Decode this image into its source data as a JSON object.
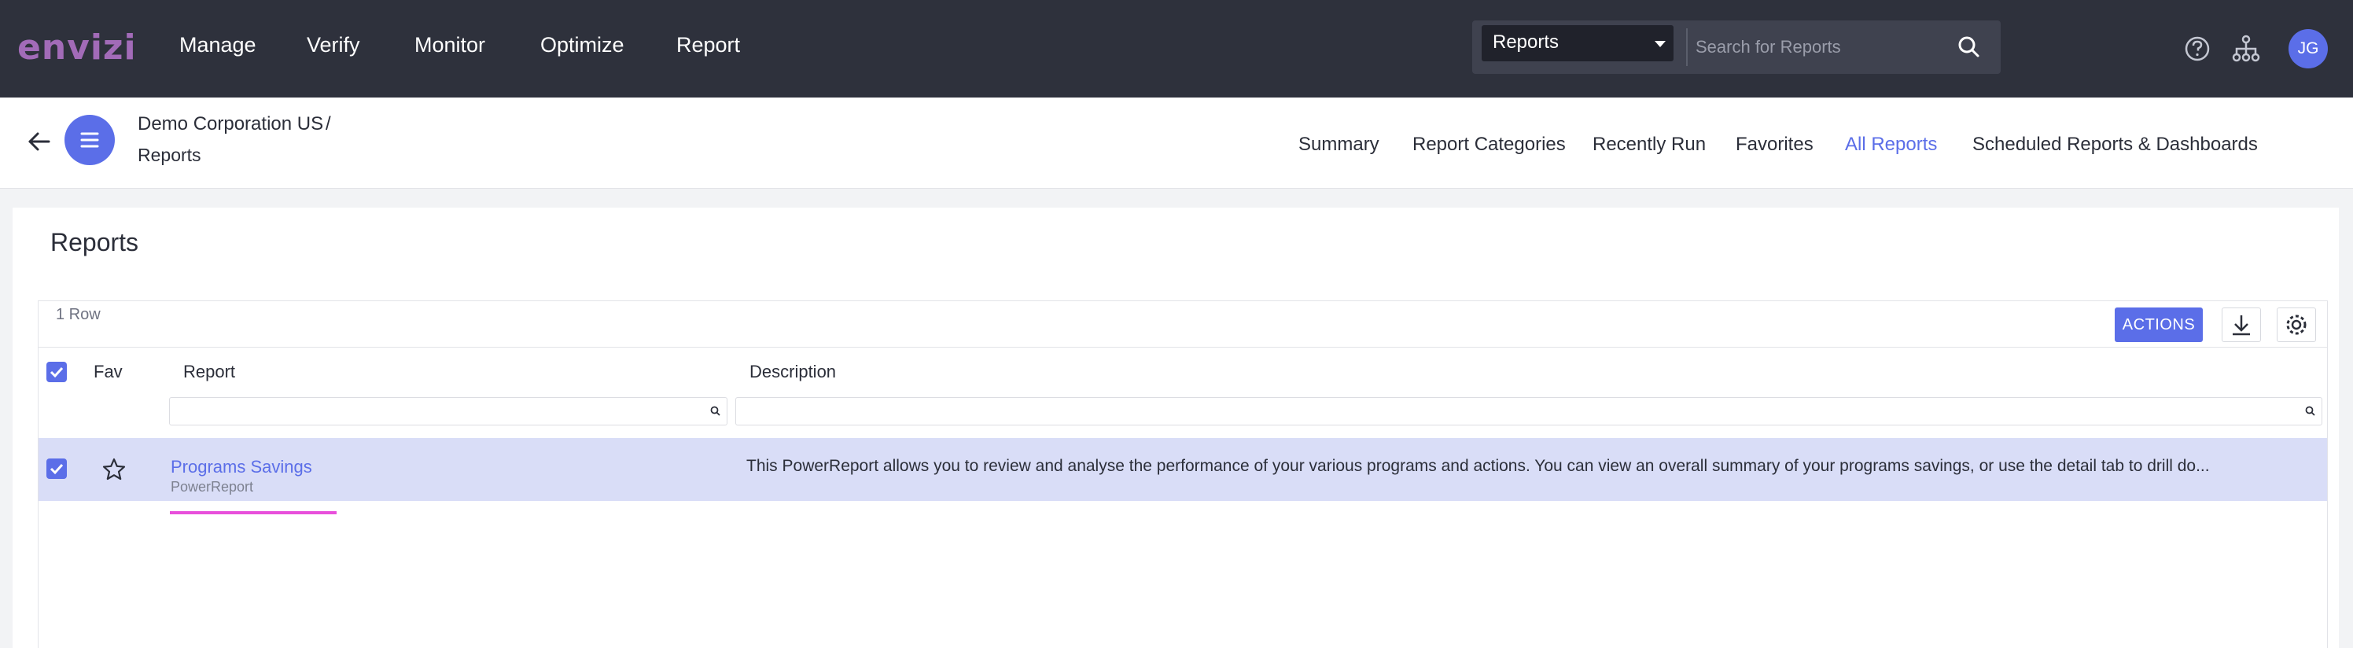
{
  "header": {
    "logo": "envizi",
    "nav": [
      "Manage",
      "Verify",
      "Monitor",
      "Optimize",
      "Report"
    ],
    "search": {
      "scope_selected": "Reports",
      "placeholder": "Search for Reports"
    },
    "icons": [
      "help-icon",
      "hierarchy-icon"
    ],
    "avatar_initials": "JG"
  },
  "subheader": {
    "breadcrumb": [
      "Demo Corporation US",
      "Reports"
    ],
    "breadcrumb_separator": "/",
    "tabs": [
      {
        "label": "Summary",
        "active": false
      },
      {
        "label": "Report Categories",
        "active": false
      },
      {
        "label": "Recently Run",
        "active": false
      },
      {
        "label": "Favorites",
        "active": false
      },
      {
        "label": "All Reports",
        "active": true
      },
      {
        "label": "Scheduled Reports & Dashboards",
        "active": false
      }
    ]
  },
  "main": {
    "title": "Reports",
    "row_count": "1 Row",
    "actions_label": "ACTIONS",
    "columns": {
      "fav": "Fav",
      "report": "Report",
      "description": "Description"
    },
    "rows": [
      {
        "selected": true,
        "favorite": false,
        "report_name": "Programs Savings",
        "report_type": "PowerReport",
        "description": "This PowerReport allows you to review and analyse the performance of your various programs and actions. You can view an overall summary of your programs savings, or use the detail tab to drill do..."
      }
    ]
  },
  "colors": {
    "topbar": "#2e313c",
    "accent": "#5b6ee8",
    "row_selected": "#d9ddf7",
    "logo": "#a26bb8",
    "highlight_mark": "#e84fdb"
  }
}
